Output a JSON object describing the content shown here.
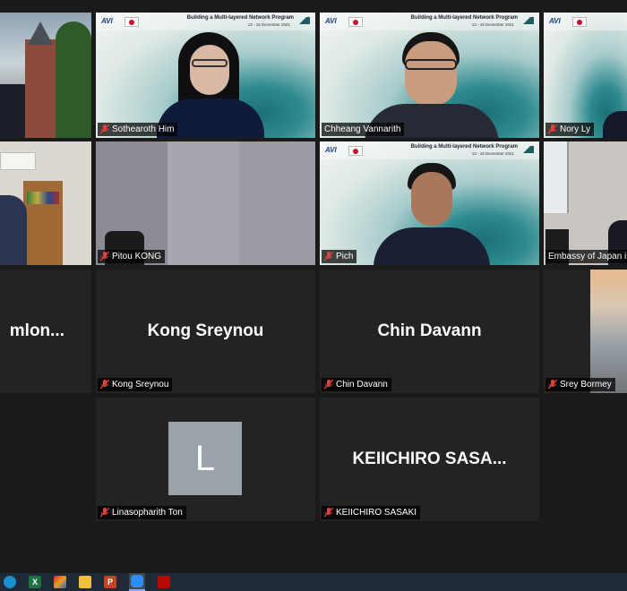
{
  "tiles": [
    {
      "name": "Sothearoth Him"
    },
    {
      "name": "Chheang Vannarith"
    },
    {
      "name": "Nory Ly"
    },
    {
      "name": "Pitou KONG"
    },
    {
      "name": "Pich"
    },
    {
      "name": "Embassy of Japan i"
    },
    {
      "name": "Kong Sreynou",
      "display": "Kong Sreynou"
    },
    {
      "name": "Chin Davann",
      "display": "Chin Davann"
    },
    {
      "name": "Srey Bormey"
    },
    {
      "name": "Linasopharith Ton",
      "avatar_letter": "L"
    },
    {
      "name": "KEIICHIRO SASAKI",
      "display": "KEIICHIRO  SASA..."
    }
  ],
  "partial_tile": {
    "display": "mlon..."
  },
  "banner": {
    "logo": "AVI",
    "title": "Building a Multi-layered Network Program",
    "date": "13 - 16 December 2021"
  },
  "colors": {
    "active_speaker": "#c9e04a",
    "mute": "#e0413a",
    "tile": "#232323"
  },
  "taskbar_icons": [
    "edge-icon",
    "excel-icon",
    "app-icon",
    "explorer-icon",
    "powerpoint-icon",
    "zoom-icon",
    "acrobat-icon"
  ]
}
